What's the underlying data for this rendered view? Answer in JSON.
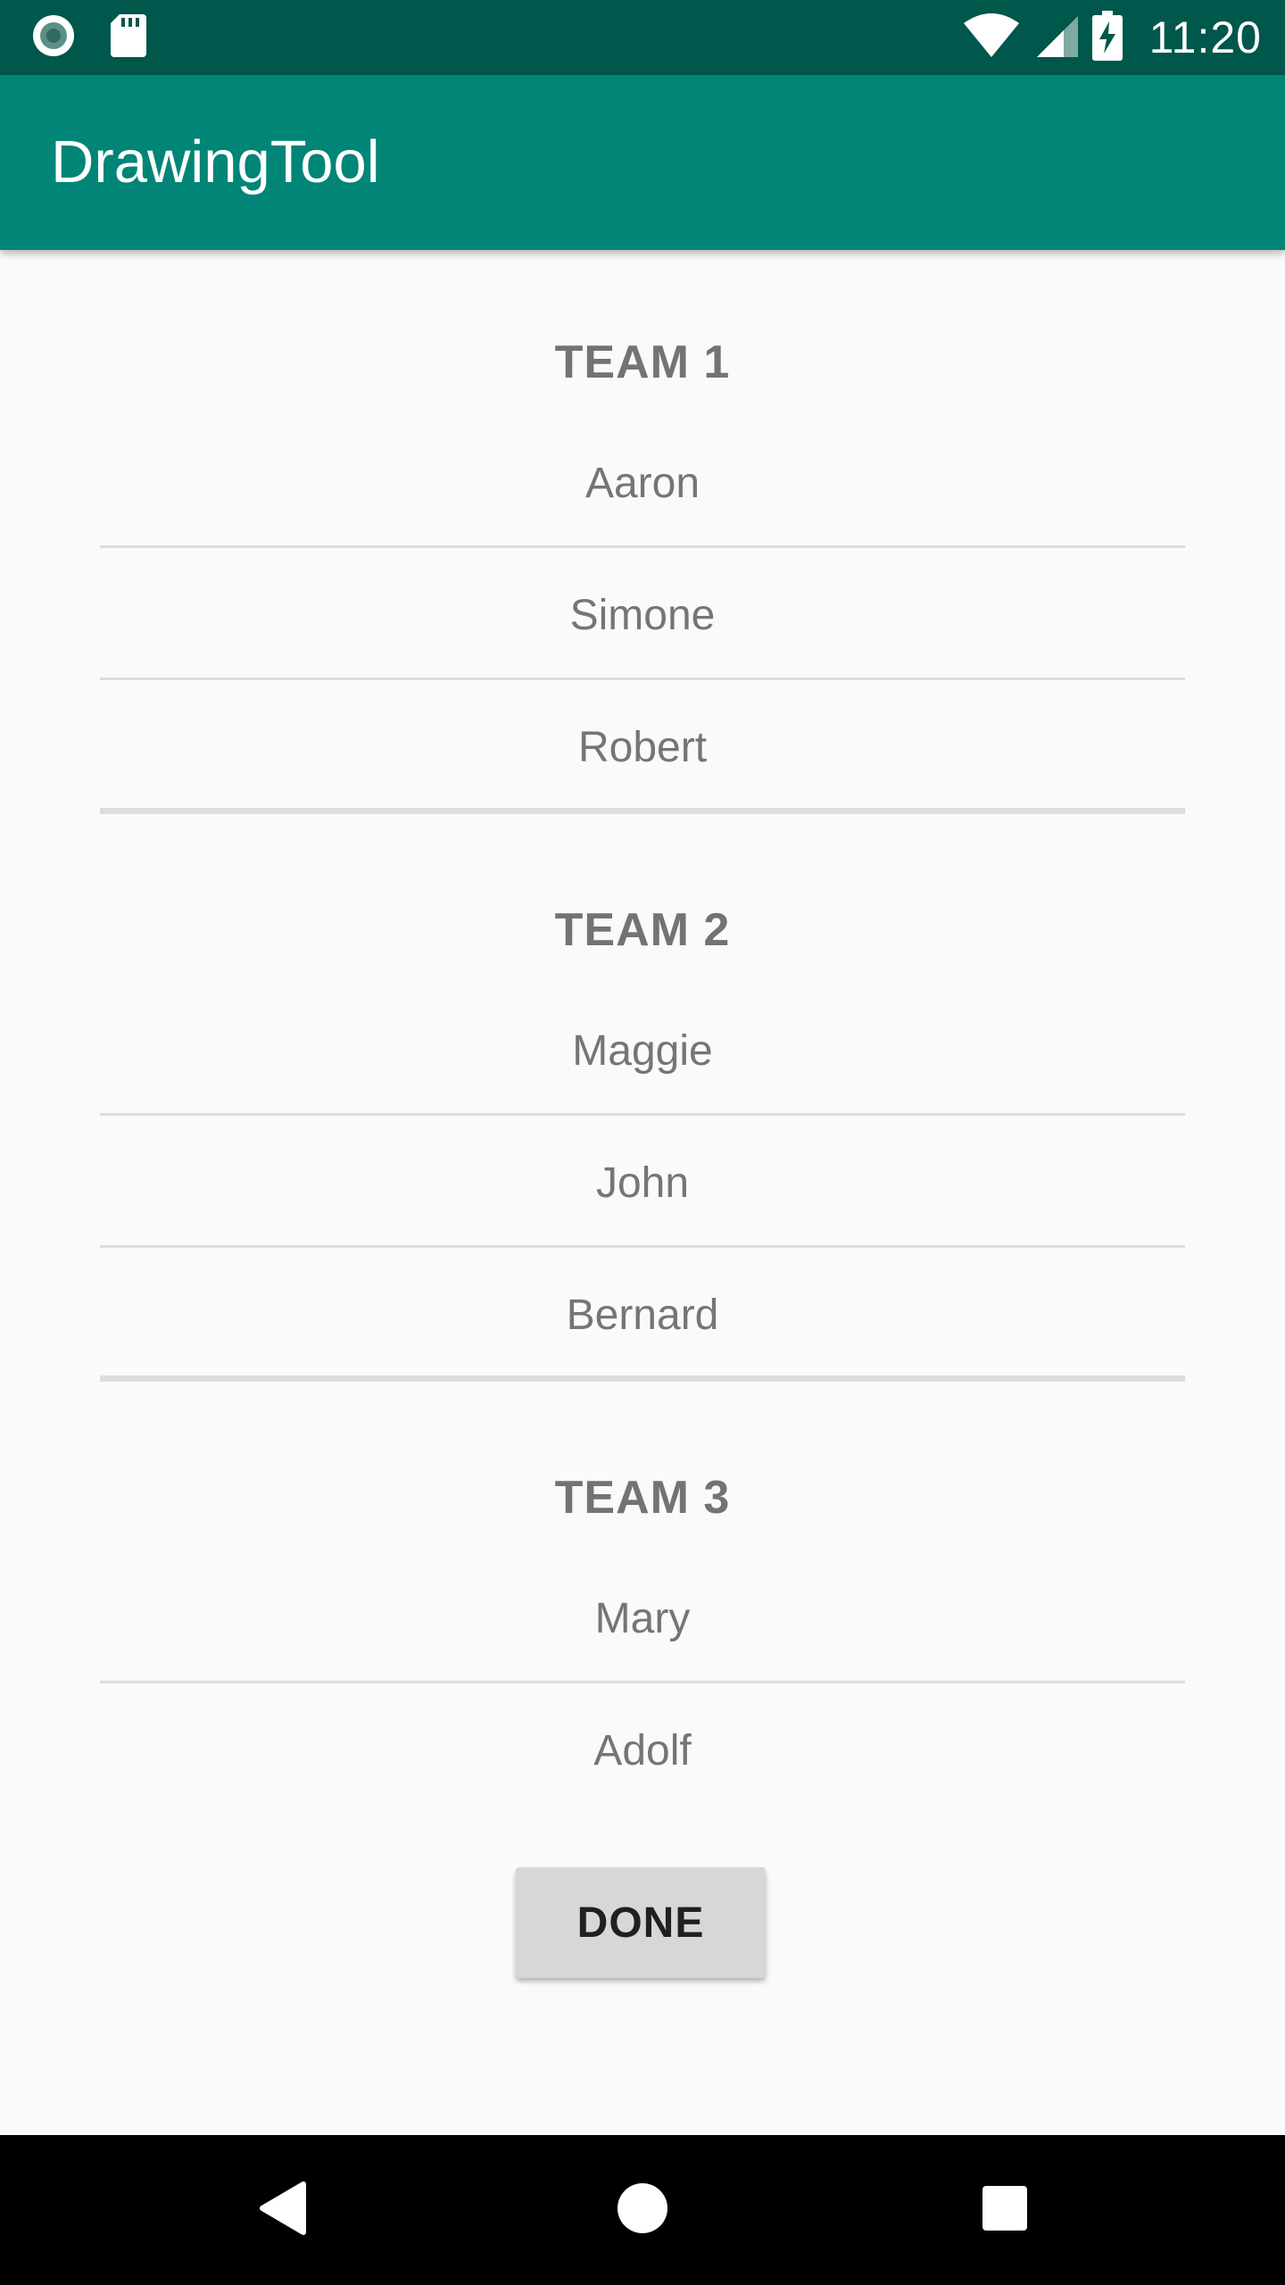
{
  "status_bar": {
    "time": "11:20",
    "icons": [
      "record-icon",
      "sd-card-icon",
      "wifi-icon",
      "signal-icon",
      "battery-charging-icon"
    ]
  },
  "app_bar": {
    "title": "DrawingTool"
  },
  "teams": [
    {
      "title": "TEAM 1",
      "members": [
        "Aaron",
        "Simone",
        "Robert"
      ]
    },
    {
      "title": "TEAM 2",
      "members": [
        "Maggie",
        "John",
        "Bernard"
      ]
    },
    {
      "title": "TEAM 3",
      "members": [
        "Mary",
        "Adolf"
      ]
    }
  ],
  "done_button": {
    "label": "DONE"
  },
  "nav_bar": {
    "icons": [
      "back-icon",
      "home-icon",
      "recents-icon"
    ]
  },
  "colors": {
    "status_bar": "#00574b",
    "app_bar": "#008577",
    "background": "#fafafa",
    "button": "#d6d7d7"
  }
}
